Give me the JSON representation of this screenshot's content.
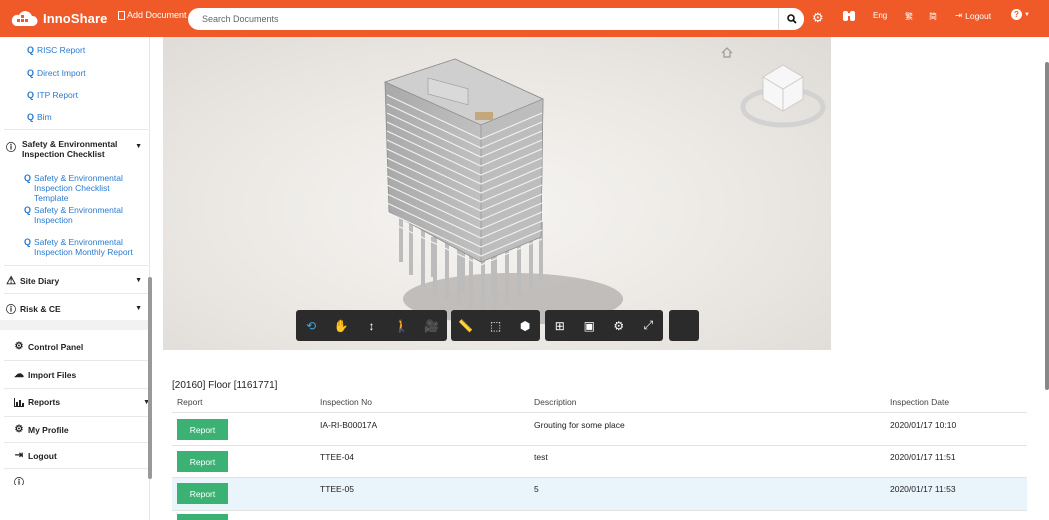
{
  "header": {
    "app_name": "InnoShare",
    "add_document": "Add Document",
    "search_placeholder": "Search Documents",
    "lang": "Eng",
    "char1": "繁",
    "char2": "简",
    "logout": "Logout"
  },
  "sidebar": {
    "bim_items": [
      "RISC Report",
      "Direct Import",
      "ITP Report",
      "Bim"
    ],
    "safety": {
      "title": "Safety & Environmental Inspection Checklist",
      "items": [
        "Safety & Environmental Inspection Checklist Template",
        "Safety & Environmental Inspection",
        "Safety & Environmental Inspection Monthly Report"
      ]
    },
    "site_diary": "Site Diary",
    "risk_ce": "Risk & CE",
    "control_panel": "Control Panel",
    "import_files": "Import Files",
    "reports": "Reports",
    "my_profile": "My Profile",
    "logout": "Logout"
  },
  "content": {
    "floor_title": "[20160] Floor [1161771]",
    "columns": [
      "Report",
      "Inspection No",
      "Description",
      "Inspection Date"
    ],
    "button_label": "Report",
    "rows": [
      {
        "no": "IA-RI-B00017A",
        "desc": "Grouting for some place",
        "date": "2020/01/17 10:10"
      },
      {
        "no": "TTEE-04",
        "desc": "test",
        "date": "2020/01/17 11:51"
      },
      {
        "no": "TTEE-05",
        "desc": "5",
        "date": "2020/01/17 11:53"
      }
    ]
  },
  "colors": {
    "header": "#f05a28",
    "link": "#2a7bd0",
    "button": "#3bb273",
    "toolbar": "#2b2b2b"
  }
}
